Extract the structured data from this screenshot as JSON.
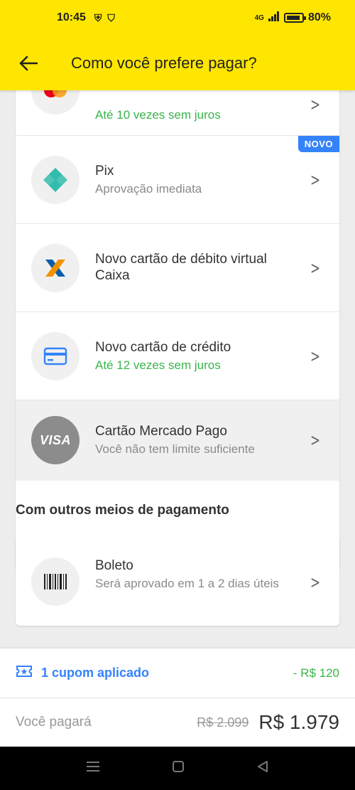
{
  "status": {
    "time": "10:45",
    "network": "4G",
    "battery": "80%"
  },
  "header": {
    "title": "Como você prefere pagar?"
  },
  "methods": [
    {
      "title": "",
      "subtitle": "Até 10 vezes sem juros",
      "icon": "mastercard-icon"
    },
    {
      "title": "Pix",
      "subtitle": "Aprovação imediata",
      "badge": "NOVO",
      "icon": "pix-icon"
    },
    {
      "title": "Novo cartão de débito virtual Caixa",
      "subtitle": "",
      "icon": "caixa-icon"
    },
    {
      "title": "Novo cartão de crédito",
      "subtitle": "Até 12 vezes sem juros",
      "icon": "credit-card-icon"
    },
    {
      "title": "Cartão Mercado Pago",
      "subtitle": "Você não tem limite suficiente",
      "icon": "visa-icon",
      "icon_text": "VISA"
    }
  ],
  "other": {
    "section_title": "Com outros meios de pagamento",
    "boleto": {
      "title": "Boleto",
      "subtitle": "Será aprovado em 1 a 2 dias úteis",
      "icon": "barcode-icon"
    }
  },
  "footer": {
    "coupon_label": "1 cupom aplicado",
    "coupon_value": "- R$ 120",
    "total_label": "Você pagará",
    "old_price": "R$ 2.099",
    "new_price": "R$ 1.979"
  },
  "colors": {
    "brand_yellow": "#ffe600",
    "accent_blue": "#3483fa",
    "success_green": "#39b54a"
  }
}
